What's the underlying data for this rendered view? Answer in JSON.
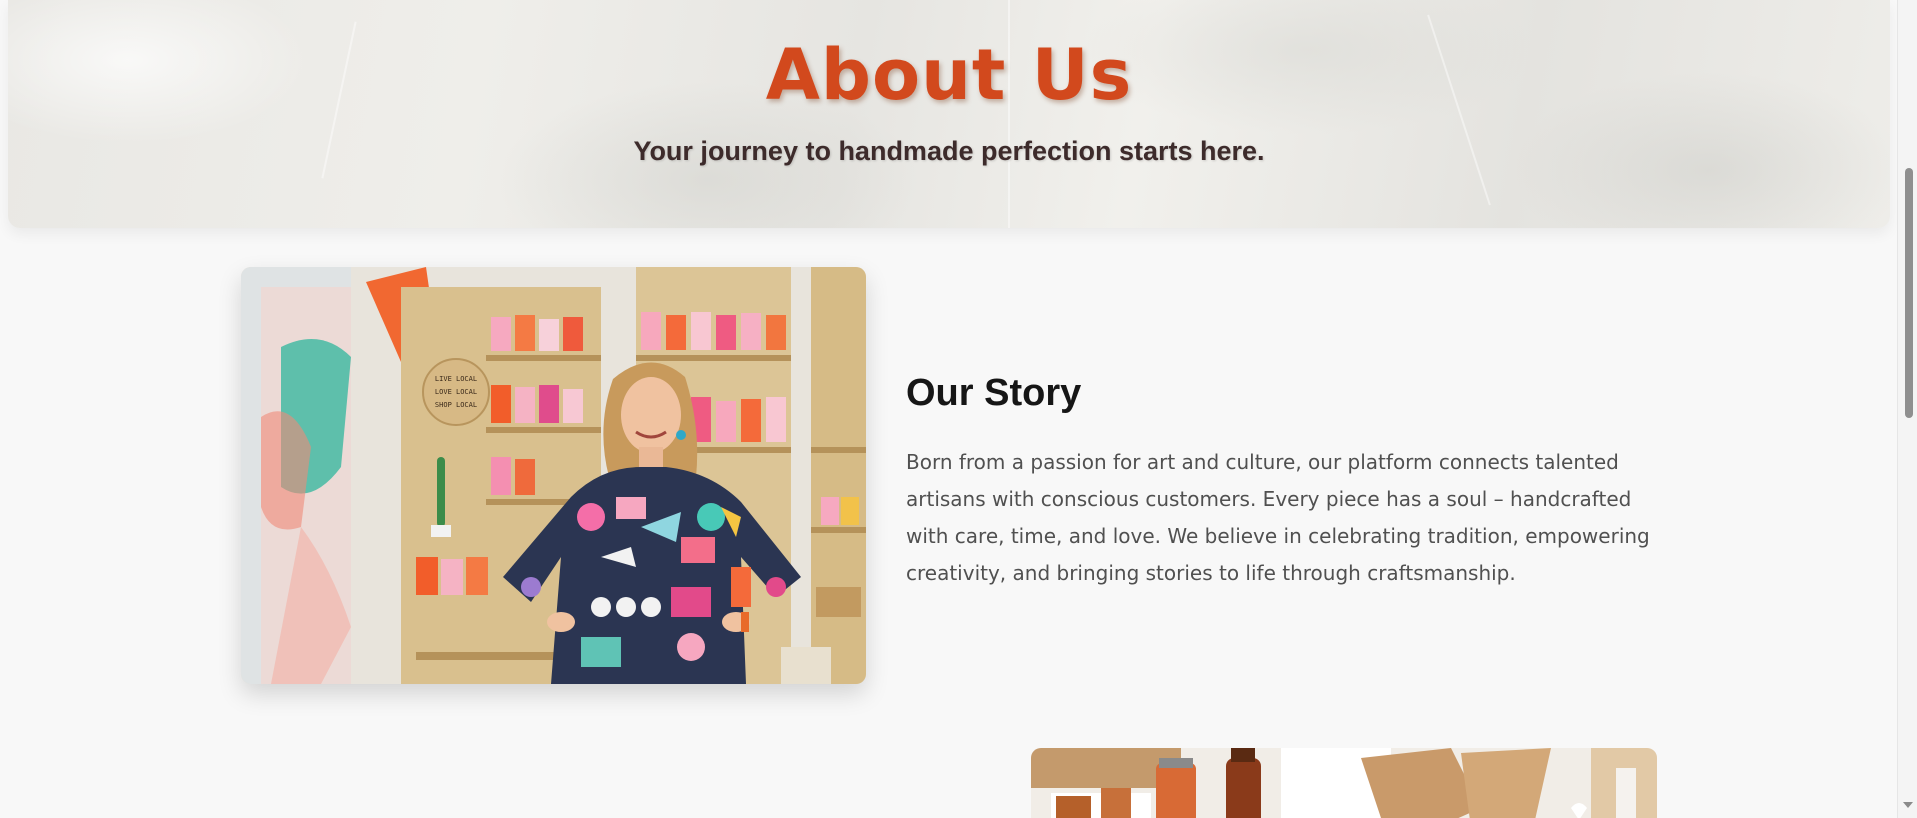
{
  "hero": {
    "title": "About Us",
    "subtitle": "Your journey to handmade perfection starts here."
  },
  "story": {
    "title": "Our Story",
    "paragraph": "Born from a passion for art and culture, our platform connects talented artisans with conscious customers. Every piece has a soul – handcrafted with care, time, and love. We believe in celebrating tradition, empowering creativity, and bringing stories to life through craftsmanship.",
    "sign_text": "LIVE LOCAL LOVE LOCAL SHOP LOCAL"
  },
  "colors": {
    "accent": "#d2491d",
    "subtitle": "#3d2b2b",
    "heading": "#161616",
    "body_text": "#505050",
    "background": "#f8f8f8"
  },
  "icons": {
    "scroll_down": "chevron-down-icon"
  }
}
